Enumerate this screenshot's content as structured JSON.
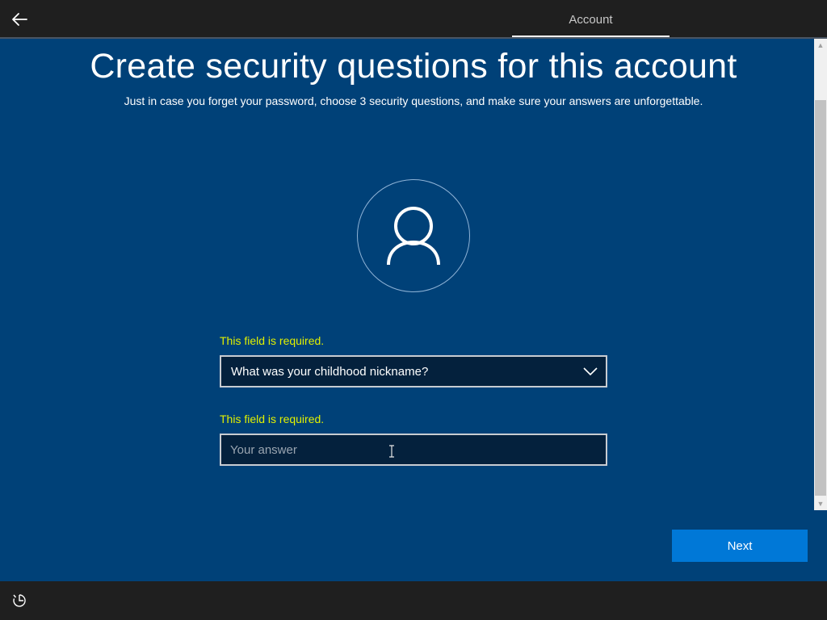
{
  "header": {
    "back_icon": "back-arrow-icon",
    "tab_label": "Account"
  },
  "main": {
    "title": "Create security questions for this account",
    "subtitle": "Just in case you forget your password, choose 3 security questions, and make sure your answers are unforgettable.",
    "avatar_icon": "user-icon",
    "question": {
      "error": "This field is required.",
      "selected": "What was your childhood nickname?",
      "chevron_icon": "chevron-down-icon"
    },
    "answer": {
      "error": "This field is required.",
      "value": "",
      "placeholder": "Your answer"
    },
    "next_label": "Next"
  },
  "footer": {
    "ease_of_access_icon": "ease-of-access-icon"
  },
  "colors": {
    "background": "#004178",
    "accent": "#0078d7",
    "error": "#e1f000",
    "bar": "#1f1f1f"
  }
}
